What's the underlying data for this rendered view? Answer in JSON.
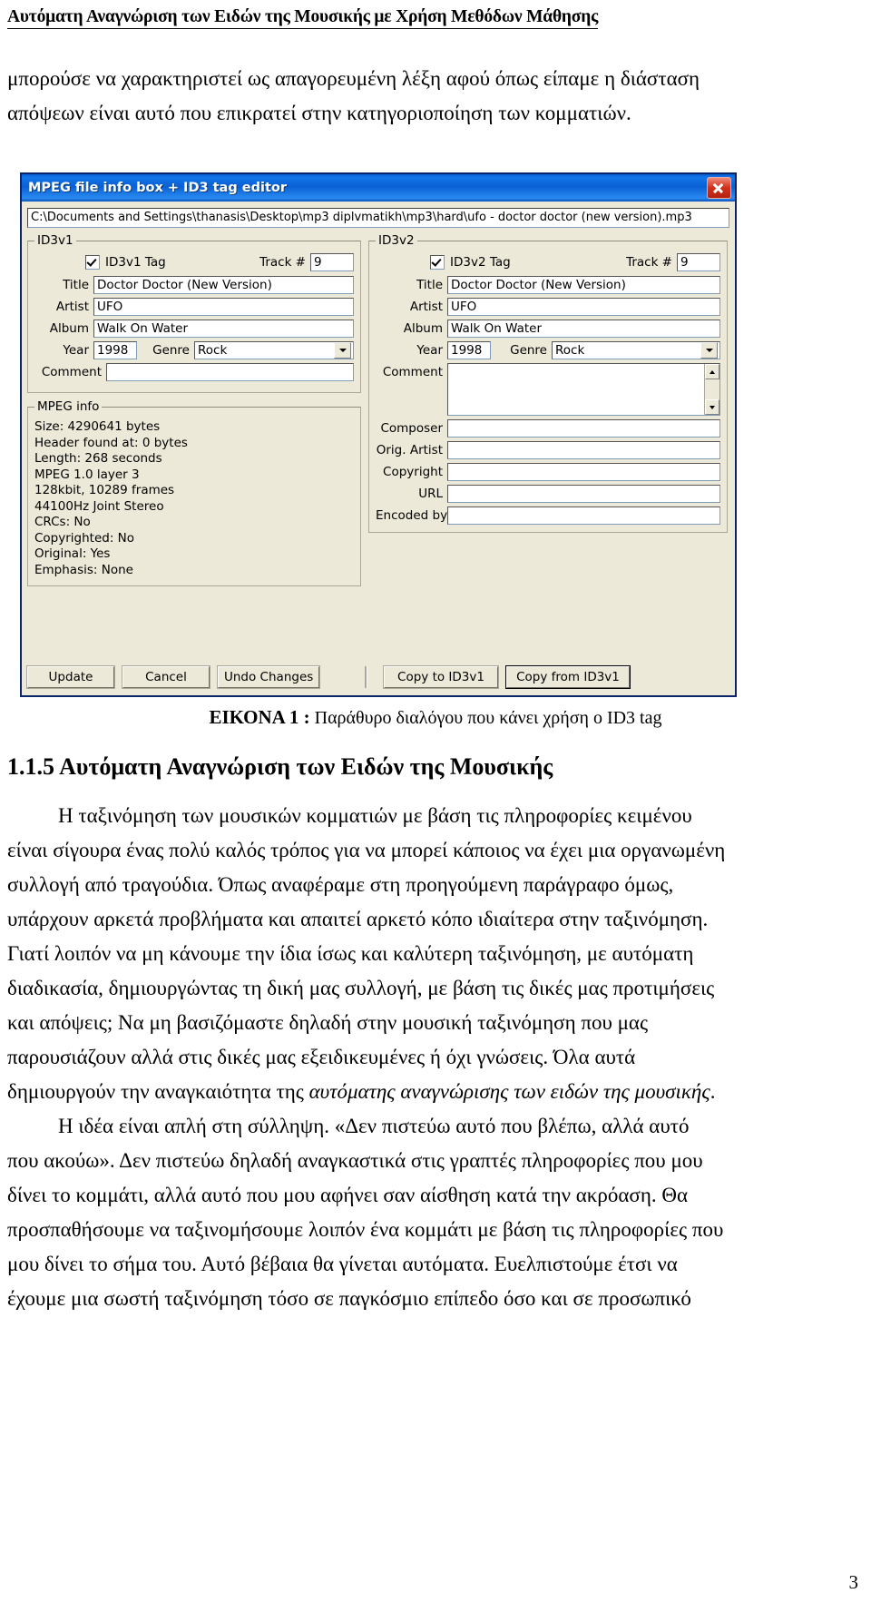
{
  "header": {
    "running_title": "Αυτόματη Αναγνώριση των Ειδών της Μουσικής με Χρήση Μεθόδων Μάθησης"
  },
  "top_paragraph": {
    "line1": "μπορούσε να χαρακτηριστεί ως απαγορευμένη λέξη αφού όπως είπαμε η διάσταση",
    "line2": "απόψεων είναι αυτό που επικρατεί στην κατηγοριοποίηση των κομματιών."
  },
  "dialog": {
    "title": "MPEG file info box + ID3 tag editor",
    "close_icon": "close-icon",
    "file_path": "C:\\Documents and Settings\\thanasis\\Desktop\\mp3 diplvmatikh\\mp3\\hard\\ufo - doctor doctor (new version).mp3",
    "id3v1": {
      "group_label": "ID3v1",
      "tag_checkbox_label": "ID3v1 Tag",
      "tag_checked": true,
      "track_label": "Track #",
      "track_value": "9",
      "title_label": "Title",
      "title_value": "Doctor Doctor (New Version)",
      "artist_label": "Artist",
      "artist_value": "UFO",
      "album_label": "Album",
      "album_value": "Walk On Water",
      "year_label": "Year",
      "year_value": "1998",
      "genre_label": "Genre",
      "genre_value": "Rock",
      "comment_label": "Comment",
      "comment_value": ""
    },
    "mpeg_info": {
      "group_label": "MPEG info",
      "lines": [
        "Size: 4290641 bytes",
        "Header found at: 0 bytes",
        "Length: 268 seconds",
        "MPEG 1.0 layer 3",
        "128kbit, 10289 frames",
        "44100Hz Joint Stereo",
        "CRCs: No",
        "Copyrighted: No",
        "Original: Yes",
        "Emphasis: None"
      ]
    },
    "id3v2": {
      "group_label": "ID3v2",
      "tag_checkbox_label": "ID3v2 Tag",
      "tag_checked": true,
      "track_label": "Track #",
      "track_value": "9",
      "title_label": "Title",
      "title_value": "Doctor Doctor (New Version)",
      "artist_label": "Artist",
      "artist_value": "UFO",
      "album_label": "Album",
      "album_value": "Walk On Water",
      "year_label": "Year",
      "year_value": "1998",
      "genre_label": "Genre",
      "genre_value": "Rock",
      "comment_label": "Comment",
      "comment_value": "",
      "composer_label": "Composer",
      "composer_value": "",
      "orig_artist_label": "Orig. Artist",
      "orig_artist_value": "",
      "copyright_label": "Copyright",
      "copyright_value": "",
      "url_label": "URL",
      "url_value": "",
      "encoded_by_label": "Encoded by",
      "encoded_by_value": ""
    },
    "buttons": {
      "update": "Update",
      "cancel": "Cancel",
      "undo_changes": "Undo Changes",
      "copy_to_id3v1": "Copy to ID3v1",
      "copy_from_id3v1": "Copy from ID3v1"
    }
  },
  "figure_caption": {
    "label": "ΕΙΚΟΝΑ 1 :",
    "text": " Παράθυρο διαλόγου που κάνει χρήση ο ID3 tag"
  },
  "section": {
    "heading": "1.1.5 Αυτόματη  Αναγνώριση  των Ειδών της Μουσικής"
  },
  "body": {
    "lines": [
      "Η ταξινόμηση των μουσικών κομματιών με βάση τις πληροφορίες κειμένου",
      "είναι σίγουρα ένας πολύ καλός τρόπος για να μπορεί κάποιος να έχει μια οργανωμένη",
      "συλλογή από τραγούδια. Όπως αναφέραμε στη προηγούμενη παράγραφο όμως,",
      "υπάρχουν αρκετά προβλήματα και απαιτεί αρκετό κόπο ιδιαίτερα στην ταξινόμηση.",
      "Γιατί λοιπόν να μη κάνουμε την ίδια ίσως και καλύτερη ταξινόμηση, με αυτόματη",
      "διαδικασία, δημιουργώντας τη δική μας συλλογή, με βάση τις δικές μας προτιμήσεις",
      "και απόψεις; Να μη βασιζόμαστε δηλαδή στην μουσική ταξινόμηση που μας",
      "παρουσιάζουν αλλά στις δικές μας εξειδικευμένες ή όχι γνώσεις. Όλα αυτά",
      "δημιουργούν την αναγκαιότητα της ",
      "αυτόματης αναγνώρισης των ειδών της μουσικής",
      ".",
      "Η ιδέα είναι απλή στη σύλληψη. «Δεν πιστεύω αυτό που βλέπω, αλλά αυτό",
      "που ακούω». Δεν πιστεύω δηλαδή αναγκαστικά στις γραπτές πληροφορίες που μου",
      "δίνει το κομμάτι, αλλά αυτό που μου αφήνει σαν αίσθηση κατά την ακρόαση. Θα",
      "προσπαθήσουμε να ταξινομήσουμε λοιπόν ένα κομμάτι με βάση τις πληροφορίες που",
      "μου δίνει το σήμα του. Αυτό βέβαια θα γίνεται αυτόματα. Ευελπιστούμε έτσι να",
      "έχουμε μια σωστή ταξινόμηση τόσο σε παγκόσμιο επίπεδο όσο και σε προσωπικό"
    ]
  },
  "page_number": "3"
}
